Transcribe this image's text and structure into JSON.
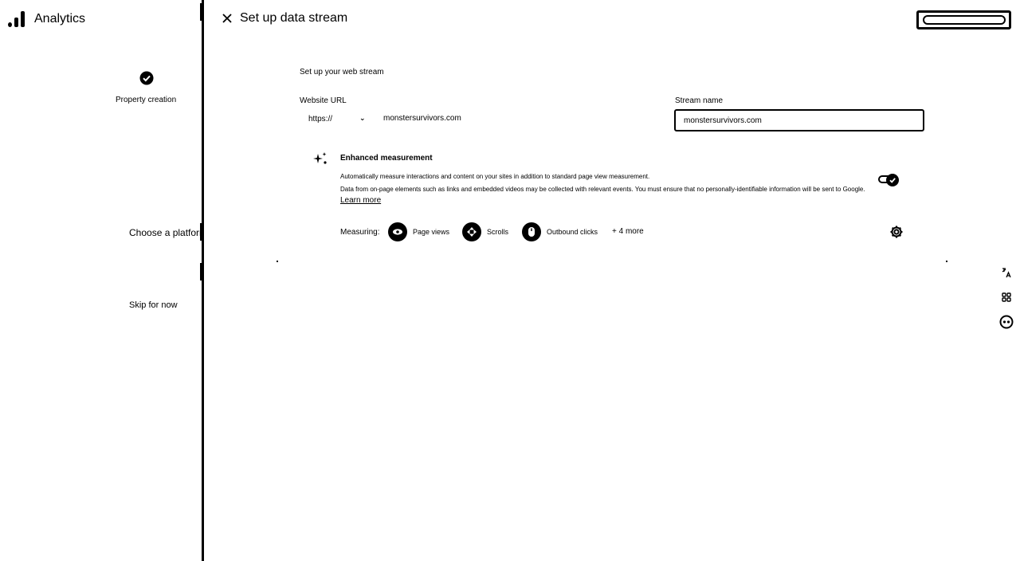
{
  "app": {
    "name": "Analytics"
  },
  "header": {
    "title": "Set up data stream",
    "close_icon": "close-icon",
    "top_right_button_label": ""
  },
  "steps": {
    "property_creation": "Property creation",
    "choose_platform": "Choose a platform",
    "skip": "Skip for now"
  },
  "form": {
    "section_title": "Set up your web stream",
    "website_url_label": "Website URL",
    "protocol_value": "https://",
    "website_url_value": "monstersurvivors.com",
    "stream_name_label": "Stream name",
    "stream_name_value": "monstersurvivors.com"
  },
  "enhanced": {
    "title": "Enhanced measurement",
    "desc_line1": "Automatically measure interactions and content on your sites in addition to standard page view measurement.",
    "desc_line2": "Data from on-page elements such as links and embedded videos may be collected with relevant events. You must ensure that no personally-identifiable information will be sent to Google.",
    "learn_more": "Learn more",
    "toggle_state": "on",
    "measuring_label": "Measuring:",
    "measures": [
      {
        "label": "Page views",
        "icon": "eye-icon"
      },
      {
        "label": "Scrolls",
        "icon": "scroll-icon"
      },
      {
        "label": "Outbound clicks",
        "icon": "mouse-click-icon"
      }
    ],
    "more": "+ 4 more"
  },
  "side_tools": [
    "translate-icon",
    "grid-icon",
    "face-icon"
  ],
  "colors": {
    "ink": "#000000",
    "background": "#ffffff"
  }
}
